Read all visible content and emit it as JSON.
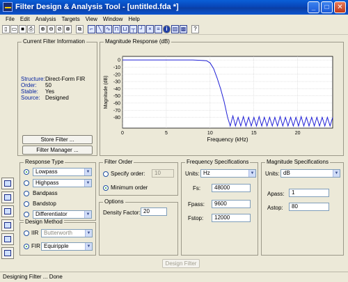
{
  "window": {
    "title": "Filter Design & Analysis Tool  - [untitled.fda *]",
    "minimize": "_",
    "maximize": "□",
    "close": "✕"
  },
  "menu": [
    "File",
    "Edit",
    "Analysis",
    "Targets",
    "View",
    "Window",
    "Help"
  ],
  "toolbar": [
    "new",
    "open",
    "save",
    "print",
    "zoom-in",
    "zoom-x",
    "zoom-y",
    "full-view",
    "new-window",
    "magnitude",
    "phase",
    "mag-phase",
    "group-delay",
    "phase-delay",
    "impulse",
    "step",
    "pole-zero",
    "coefficients",
    "info",
    "round-off",
    "noise",
    "whats-this"
  ],
  "current_filter": {
    "title": "Current Filter Information",
    "rows": [
      {
        "key": "Structure:",
        "value": "Direct-Form FIR"
      },
      {
        "key": "Order:",
        "value": "50"
      },
      {
        "key": "Stable:",
        "value": "Yes"
      },
      {
        "key": "Source:",
        "value": "Designed"
      }
    ],
    "store_button": "Store Filter ...",
    "manager_button": "Filter Manager ..."
  },
  "magnitude_panel": {
    "title": "Magnitude Response (dB)"
  },
  "chart_data": {
    "type": "line",
    "title": "",
    "xlabel": "Frequency (kHz)",
    "ylabel": "Magnitude (dB)",
    "xlim": [
      0,
      24
    ],
    "ylim": [
      -95,
      5
    ],
    "xticks": [
      0,
      5,
      10,
      15,
      20
    ],
    "yticks": [
      0,
      -10,
      -20,
      -30,
      -40,
      -50,
      -60,
      -70,
      -80
    ],
    "grid": true,
    "series": [
      {
        "color": "#1f1fd6",
        "x": [
          0,
          2,
          4,
          6,
          8,
          9,
          9.6,
          10,
          10.4,
          10.8,
          11.2,
          11.6,
          12,
          12.3,
          12.6,
          12.9,
          13.2,
          13.5,
          13.8,
          14.1,
          14.4,
          14.7,
          15,
          15.3,
          15.6,
          15.9,
          16.2,
          16.5,
          16.8,
          17.1,
          17.4,
          17.7,
          18,
          18.3,
          18.6,
          18.9,
          19.2,
          19.5,
          19.8,
          20.1,
          20.4,
          20.7,
          21,
          21.3,
          21.6,
          21.9,
          22.2,
          22.5,
          22.8,
          23.1,
          23.4,
          23.7,
          24
        ],
        "y": [
          0,
          0,
          0,
          0,
          0,
          -0.5,
          -1,
          -4,
          -12,
          -25,
          -40,
          -58,
          -80,
          -92,
          -78,
          -92,
          -80,
          -92,
          -79,
          -92,
          -80,
          -92,
          -80,
          -92,
          -79,
          -92,
          -80,
          -92,
          -80,
          -92,
          -80,
          -92,
          -79,
          -92,
          -80,
          -92,
          -80,
          -92,
          -80,
          -92,
          -79,
          -92,
          -80,
          -92,
          -80,
          -92,
          -80,
          -92,
          -80,
          -92,
          -80,
          -92,
          -80
        ]
      }
    ]
  },
  "response_type": {
    "title": "Response Type",
    "options": [
      {
        "label": "Lowpass",
        "selected": true
      },
      {
        "label": "Highpass",
        "selected": false
      },
      {
        "label": "Bandpass",
        "selected": false
      },
      {
        "label": "Bandstop",
        "selected": false
      },
      {
        "label": "Differentiator",
        "selected": false
      }
    ],
    "lowpass_select": "Lowpass",
    "highpass_select": "Highpass",
    "diff_select": "Differentiator"
  },
  "design_method": {
    "title": "Design Method",
    "iir_label": "IIR",
    "iir_value": "Butterworth",
    "fir_label": "FIR",
    "fir_value": "Equiripple"
  },
  "filter_order": {
    "title": "Filter Order",
    "specify_label": "Specify order:",
    "specify_value": "10",
    "minimum_label": "Minimum order"
  },
  "options": {
    "title": "Options",
    "density_label": "Density Factor:",
    "density_value": "20"
  },
  "frequency_specs": {
    "title": "Frequency Specifications",
    "units_label": "Units:",
    "units_value": "Hz",
    "fs_label": "Fs:",
    "fs_value": "48000",
    "fpass_label": "Fpass:",
    "fpass_value": "9600",
    "fstop_label": "Fstop:",
    "fstop_value": "12000"
  },
  "magnitude_specs": {
    "title": "Magnitude Specifications",
    "units_label": "Units:",
    "units_value": "dB",
    "apass_label": "Apass:",
    "apass_value": "1",
    "astop_label": "Astop:",
    "astop_value": "80"
  },
  "design_button": "Design Filter",
  "status": "Designing Filter ... Done"
}
